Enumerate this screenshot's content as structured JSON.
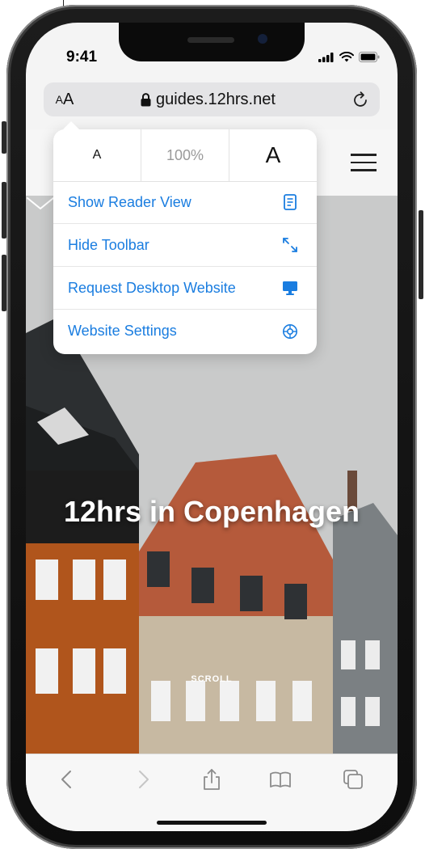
{
  "status_bar": {
    "time": "9:41"
  },
  "address_bar": {
    "text_size_small": "A",
    "text_size_large": "A",
    "url": "guides.12hrs.net",
    "lock_icon": "lock-icon",
    "reload_icon": "reload-icon"
  },
  "popover": {
    "zoom_smaller": "A",
    "zoom_level": "100%",
    "zoom_larger": "A",
    "items": [
      {
        "label": "Show Reader View",
        "icon": "reader-view-icon"
      },
      {
        "label": "Hide Toolbar",
        "icon": "expand-arrows-icon"
      },
      {
        "label": "Request Desktop Website",
        "icon": "desktop-icon"
      },
      {
        "label": "Website Settings",
        "icon": "gear-icon"
      }
    ],
    "accent_color": "#1a7de0"
  },
  "page": {
    "hero_title": "12hrs in Copenhagen",
    "scroll_label": "SCROLL"
  },
  "toolbar": {
    "items": [
      "back-icon",
      "forward-icon",
      "share-icon",
      "bookmarks-icon",
      "tabs-icon"
    ]
  }
}
